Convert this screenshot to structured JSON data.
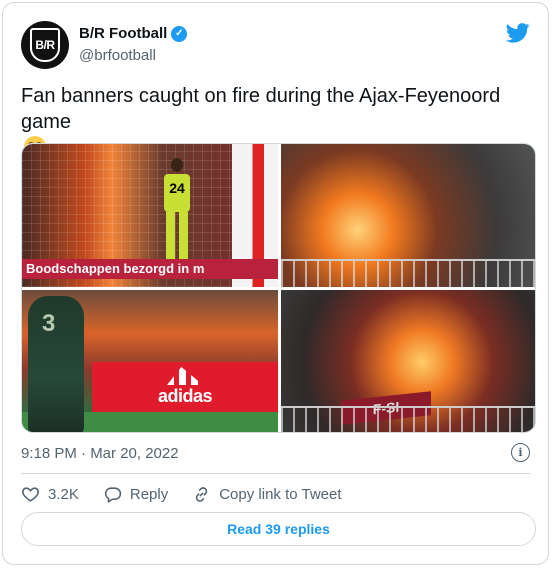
{
  "tweet": {
    "author_name": "B/R Football",
    "author_handle": "@brfootball",
    "avatar_text": "B/R",
    "text": "Fan banners caught on fire during the Ajax-Feyenoord game",
    "emoji": "flushed-face",
    "timestamp": "9:18 PM · Mar 20, 2022"
  },
  "media": {
    "photo1_board_text": "Boodschappen bezorgd in m",
    "photo1_jersey_number": "24",
    "photo3_ad_text": "adidas",
    "photo3_jersey_number": "3",
    "photo4_banner_text": "F-SI"
  },
  "actions": {
    "likes": "3.2K",
    "reply_label": "Reply",
    "copy_link_label": "Copy link to Tweet"
  },
  "read_replies_label": "Read 39 replies",
  "colors": {
    "accent": "#1d9bf0",
    "secondary_text": "#536471",
    "border": "#cfd9de"
  }
}
